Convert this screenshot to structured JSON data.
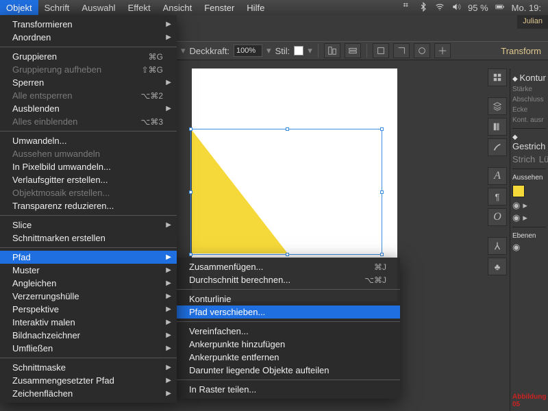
{
  "menubar": {
    "items": [
      "Objekt",
      "Schrift",
      "Auswahl",
      "Effekt",
      "Ansicht",
      "Fenster",
      "Hilfe"
    ],
    "active_index": 0
  },
  "status": {
    "battery_pct": "95 %",
    "day_time": "Mo. 19:",
    "user": "Julian"
  },
  "optionbar": {
    "opacity_label": "Deckkraft:",
    "opacity_value": "100%",
    "style_label": "Stil:",
    "transform_link": "Transform"
  },
  "objekt_menu": [
    {
      "label": "Transformieren",
      "sub": true
    },
    {
      "label": "Anordnen",
      "sub": true
    },
    {
      "sep": true
    },
    {
      "label": "Gruppieren",
      "sc": "⌘G"
    },
    {
      "label": "Gruppierung aufheben",
      "sc": "⇧⌘G",
      "dis": true
    },
    {
      "label": "Sperren",
      "sub": true
    },
    {
      "label": "Alle entsperren",
      "sc": "⌥⌘2",
      "dis": true
    },
    {
      "label": "Ausblenden",
      "sub": true
    },
    {
      "label": "Alles einblenden",
      "sc": "⌥⌘3",
      "dis": true
    },
    {
      "sep": true
    },
    {
      "label": "Umwandeln..."
    },
    {
      "label": "Aussehen umwandeln",
      "dis": true
    },
    {
      "label": "In Pixelbild umwandeln..."
    },
    {
      "label": "Verlaufsgitter erstellen..."
    },
    {
      "label": "Objektmosaik erstellen...",
      "dis": true
    },
    {
      "label": "Transparenz reduzieren..."
    },
    {
      "sep": true
    },
    {
      "label": "Slice",
      "sub": true
    },
    {
      "label": "Schnittmarken erstellen"
    },
    {
      "sep": true
    },
    {
      "label": "Pfad",
      "sub": true,
      "sel": true
    },
    {
      "label": "Muster",
      "sub": true
    },
    {
      "label": "Angleichen",
      "sub": true
    },
    {
      "label": "Verzerrungshülle",
      "sub": true
    },
    {
      "label": "Perspektive",
      "sub": true
    },
    {
      "label": "Interaktiv malen",
      "sub": true
    },
    {
      "label": "Bildnachzeichner",
      "sub": true
    },
    {
      "label": "Umfließen",
      "sub": true
    },
    {
      "sep": true
    },
    {
      "label": "Schnittmaske",
      "sub": true
    },
    {
      "label": "Zusammengesetzter Pfad",
      "sub": true
    },
    {
      "label": "Zeichenflächen",
      "sub": true
    }
  ],
  "pfad_submenu": [
    {
      "label": "Zusammenfügen...",
      "sc": "⌘J"
    },
    {
      "label": "Durchschnitt berechnen...",
      "sc": "⌥⌘J"
    },
    {
      "sep": true
    },
    {
      "label": "Konturlinie"
    },
    {
      "label": "Pfad verschieben...",
      "sel": true
    },
    {
      "sep": true
    },
    {
      "label": "Vereinfachen..."
    },
    {
      "label": "Ankerpunkte hinzufügen"
    },
    {
      "label": "Ankerpunkte entfernen"
    },
    {
      "label": "Darunter liegende Objekte aufteilen"
    },
    {
      "sep": true
    },
    {
      "label": "In Raster teilen..."
    }
  ],
  "panels": {
    "kontur": "Kontur",
    "starke": "Stärke",
    "abschluss": "Abschluss",
    "ecke": "Ecke",
    "kontausn": "Kont. ausr",
    "gestrich": "Gestrich",
    "strich": "Strich",
    "lu": "Lü",
    "aussehen": "Aussehen",
    "ebenen": "Ebenen",
    "caption": "Abbildung 05"
  },
  "colors": {
    "highlight": "#1f6fe0",
    "triangle": "#f5d93a"
  }
}
